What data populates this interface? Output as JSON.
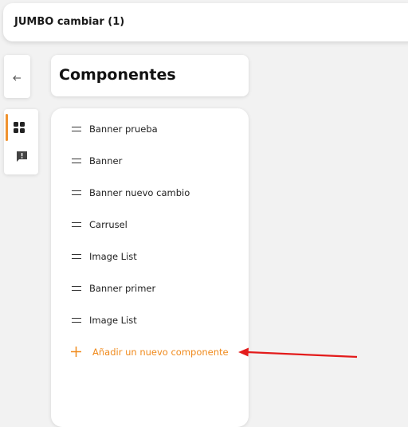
{
  "header": {
    "title": "JUMBO cambiar (1)"
  },
  "panel": {
    "heading": "Componentes"
  },
  "components": [
    {
      "label": "Banner prueba"
    },
    {
      "label": "Banner"
    },
    {
      "label": "Banner nuevo cambio"
    },
    {
      "label": "Carrusel"
    },
    {
      "label": "Image List"
    },
    {
      "label": "Banner primer"
    },
    {
      "label": "Image List"
    }
  ],
  "add_component": {
    "label": "Añadir un nuevo componente"
  },
  "icons": {
    "back": "arrow-left-icon",
    "components": "grid-icon",
    "feedback": "feedback-icon",
    "drag": "drag-handle-icon",
    "add": "plus-icon"
  },
  "colors": {
    "accent": "#f08a1c",
    "annotation_arrow": "#e31b1b",
    "background": "#f2f2f2"
  }
}
